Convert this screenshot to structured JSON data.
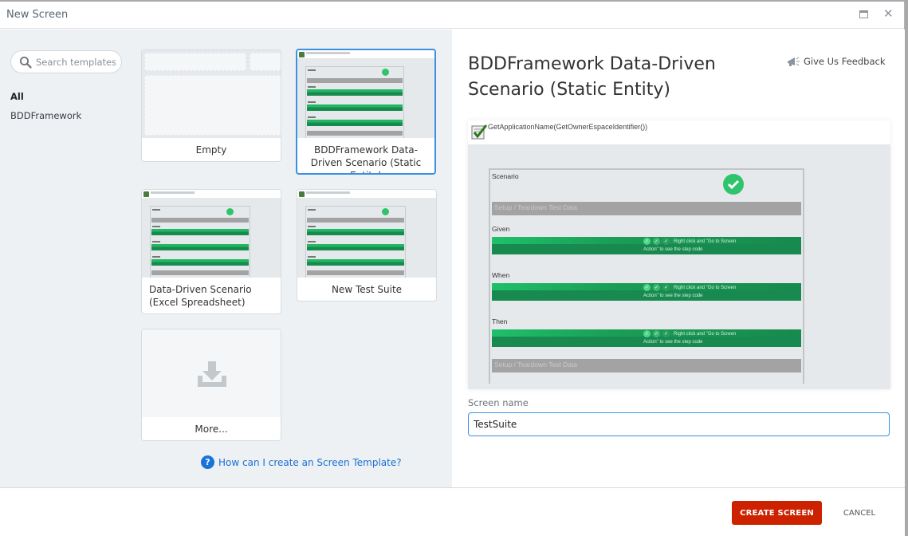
{
  "window": {
    "title": "New Screen",
    "maximize_icon": "maximize-icon",
    "close_icon": "close-icon"
  },
  "sidebar": {
    "search_placeholder": "Search templates",
    "categories": [
      {
        "label": "All",
        "selected": true
      },
      {
        "label": "BDDFramework",
        "selected": false
      }
    ]
  },
  "templates": [
    {
      "label": "Empty",
      "selected": false
    },
    {
      "label": "BDDFramework Data-Driven Scenario (Static Entity)",
      "selected": true
    },
    {
      "label": "Data-Driven Scenario (Excel Spreadsheet)",
      "selected": false
    },
    {
      "label": "New Test Suite",
      "selected": false
    },
    {
      "label": "More...",
      "selected": false,
      "icon": "download-icon"
    }
  ],
  "help_link": "How can I create an Screen Template?",
  "details": {
    "title": "BDDFramework Data-Driven Scenario (Static Entity)",
    "feedback_label": "Give Us Feedback",
    "preview": {
      "header_text": "GetApplicationName(GetOwnerEspaceIdentifier())",
      "sections": {
        "scenario": "Scenario",
        "setup": "Setup / Teardown Test Data",
        "given": "Given",
        "when": "When",
        "then": "Then",
        "teardown": "Setup / Teardown Test Data"
      },
      "step_hint_line1": "Right click and \"Go to Screen",
      "step_hint_line2": "Action\" to see the step code"
    },
    "screen_name_label": "Screen name",
    "screen_name_value": "TestSuite"
  },
  "footer": {
    "create_label": "CREATE SCREEN",
    "cancel_label": "CANCEL"
  },
  "colors": {
    "primary_button": "#cc2200",
    "selection": "#3d8fe0",
    "link": "#1a6fd1",
    "step_green": "#188a50"
  }
}
